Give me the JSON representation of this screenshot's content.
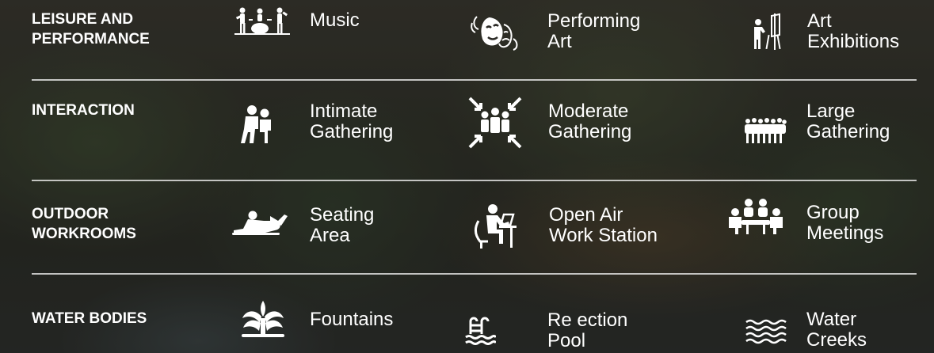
{
  "rows": [
    {
      "category": "LEISURE AND\nPERFORMANCE",
      "items": [
        {
          "label": "Music",
          "icon": "band-icon"
        },
        {
          "label": "Performing\nArt",
          "icon": "theater-masks-icon"
        },
        {
          "label": "Art\nExhibitions",
          "icon": "easel-painter-icon"
        }
      ]
    },
    {
      "category": "INTERACTION",
      "items": [
        {
          "label": "Intimate\nGathering",
          "icon": "couple-icon"
        },
        {
          "label": "Moderate\nGathering",
          "icon": "group-converge-icon"
        },
        {
          "label": "Large\nGathering",
          "icon": "crowd-icon"
        }
      ]
    },
    {
      "category": "OUTDOOR\nWORKROOMS",
      "items": [
        {
          "label": "Seating\nArea",
          "icon": "lounging-person-icon"
        },
        {
          "label": "Open Air\nWork Station",
          "icon": "laptop-worker-icon"
        },
        {
          "label": "Group\nMeetings",
          "icon": "meeting-table-icon"
        }
      ]
    },
    {
      "category": "WATER BODIES",
      "items": [
        {
          "label": "Fountains",
          "icon": "fountain-icon"
        },
        {
          "label": "Re  ection\nPool",
          "icon": "pool-ladder-icon"
        },
        {
          "label": "Water\nCreeks",
          "icon": "waves-icon"
        }
      ]
    }
  ],
  "colors": {
    "text": "#ffffff",
    "divider": "#ebebeb"
  }
}
